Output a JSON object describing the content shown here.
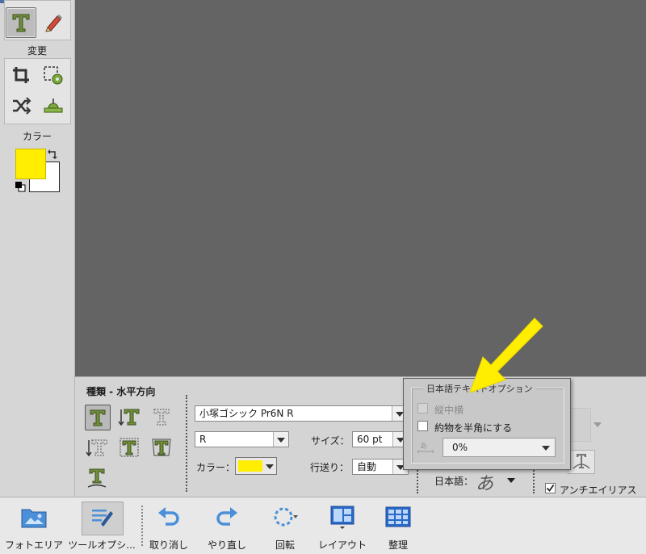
{
  "left_toolbar": {
    "group_modify_label": "変更",
    "color_label": "カラー",
    "foreground_color": "#ffee00",
    "background_color": "#ffffff"
  },
  "options": {
    "type_label": "種類 - 水平方向",
    "font_family": "小塚ゴシック Pr6N R",
    "font_style": "R",
    "size_label": "サイズ：",
    "size_value": "60 pt",
    "color_label": "カラー：",
    "text_color": "#ffee00",
    "leading_label": "行送り：",
    "leading_value": "自動",
    "japanese_label": "日本語：",
    "japanese_glyph": "あ",
    "antialias_label": "アンチエイリアス",
    "antialias_checked": true
  },
  "japanese_popup": {
    "title": "日本語テキストオプション",
    "tatechuyoko_label": "縦中横",
    "half_width_label": "約物を半角にする",
    "tsume_value": "0%"
  },
  "bottom_bar": {
    "photo_area": "フォトエリア",
    "tool_options": "ツールオプシ...",
    "undo": "取り消し",
    "redo": "やり直し",
    "rotate": "回転",
    "layout": "レイアウト",
    "organize": "整理"
  }
}
